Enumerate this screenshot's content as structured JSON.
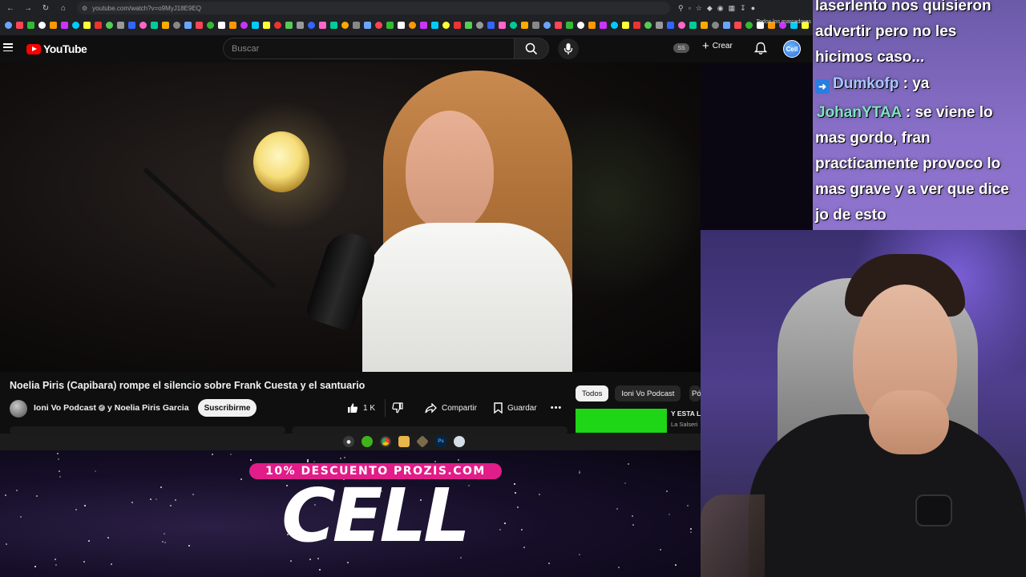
{
  "browser": {
    "url": "youtube.com/watch?v=o9MyJ18E9EQ",
    "bookmarks_all_label": "Todos los marcadores"
  },
  "youtube": {
    "logo_text": "YouTube",
    "search_placeholder": "Buscar",
    "user_badge": "SS",
    "create_label": "Crear",
    "avatar_text": "Cell"
  },
  "video": {
    "title": "Noelia Piris (Capibara) rompe el silencio sobre Frank Cuesta y el santuario",
    "channel": "Ioni Vo Podcast",
    "coauthor": "y Noelia Piris Garcia",
    "subscribe_label": "Suscribirme",
    "likes": "1 K",
    "share_label": "Compartir",
    "save_label": "Guardar"
  },
  "sidebar": {
    "chips": [
      "Todos",
      "Ioni Vo Podcast",
      "Pó"
    ],
    "recommendation": {
      "title": "Y ESTA L",
      "channel": "La Salseri",
      "thumb_color": "#1ed516"
    }
  },
  "overlay": {
    "promo": "10% DESCUENTO PROZIS.COM",
    "brand": "CELL",
    "promo_color": "#e01d88"
  },
  "chat": {
    "lines": [
      {
        "text": "laserlento nos quisieron"
      },
      {
        "text": "advertir pero no les"
      },
      {
        "text": "hicimos caso..."
      },
      {
        "user": "Dumkofp",
        "text": " : ya",
        "user_color": "#a9c6ff"
      },
      {
        "user": "JohanYTAA",
        "text": " : se viene lo",
        "user_color": "#7fe3c1"
      },
      {
        "text": "mas gordo, fran"
      },
      {
        "text": "practicamente provoco lo"
      },
      {
        "text": "mas grave y a ver que dice"
      },
      {
        "text": "jo de esto"
      }
    ]
  }
}
